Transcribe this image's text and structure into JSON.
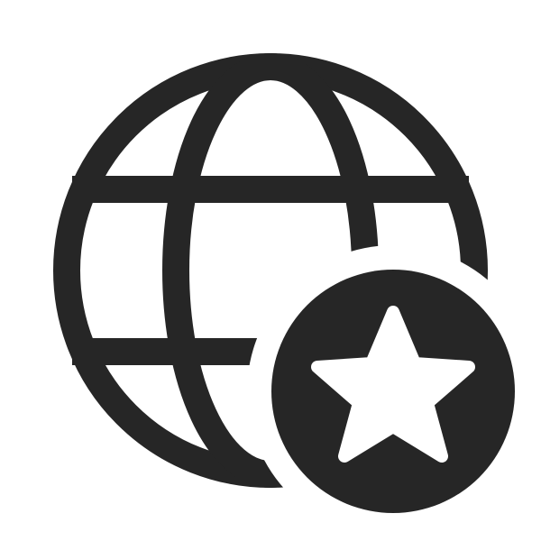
{
  "icon": {
    "name": "globe-star-icon",
    "parts": [
      "globe-icon",
      "star-badge-icon",
      "star-icon"
    ],
    "colors": {
      "foreground": "#262626",
      "background": "#ffffff"
    }
  }
}
